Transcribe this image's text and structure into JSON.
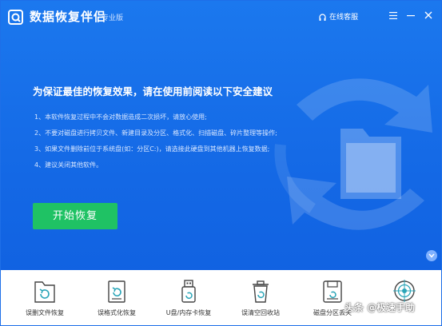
{
  "app": {
    "title": "数据恢复伴侣",
    "edition": "专业版",
    "support_label": "在线客服"
  },
  "main": {
    "heading": "为保证最佳的恢复效果，请在使用前阅读以下安全建议",
    "tips": [
      "1、本软件恢复过程中不会对数据造成二次损坏，请放心使用;",
      "2、不要对磁盘进行拷贝文件、新建目录及分区、格式化、扫描磁盘、碎片整理等操作;",
      "3、如果文件删除前位于系统盘(如：分区C:)，请选接此硬盘到其他机器上恢复数据;",
      "4、建议关闭其他软件。"
    ],
    "start_label": "开始恢复"
  },
  "tools": [
    {
      "label": "误删文件恢复",
      "icon": "folder-restore-icon"
    },
    {
      "label": "误格式化恢复",
      "icon": "document-restore-icon"
    },
    {
      "label": "U盘/内存卡恢复",
      "icon": "usb-drive-icon"
    },
    {
      "label": "误清空回收站",
      "icon": "recycle-bin-icon"
    },
    {
      "label": "磁盘分区丢失",
      "icon": "disk-partition-icon"
    },
    {
      "label": "",
      "icon": "deep-scan-icon"
    }
  ],
  "watermark": "头条 @极速手助",
  "colors": {
    "primary": "#1468e5",
    "start_button": "#1fc264",
    "icon_accent": "#2aa5b8"
  }
}
